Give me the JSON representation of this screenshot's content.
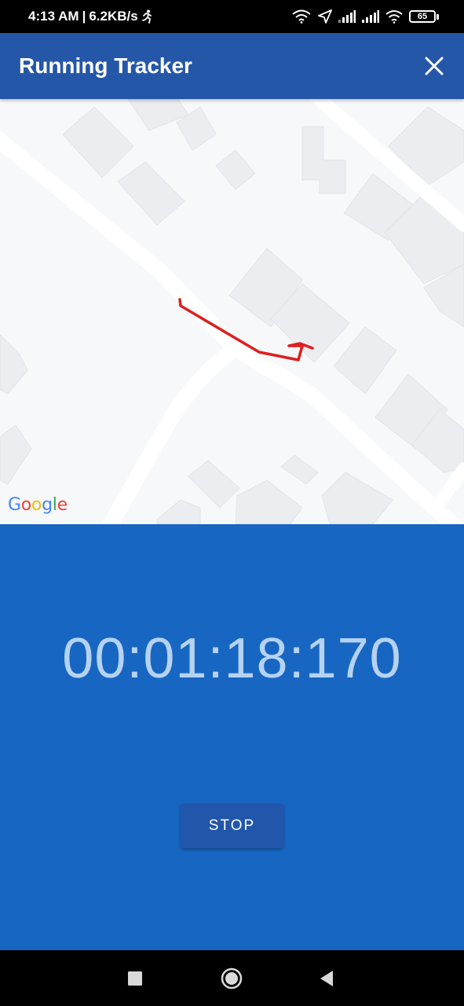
{
  "status_bar": {
    "time": "4:13 AM",
    "separator": "|",
    "network_speed": "6.2KB/s",
    "battery_level": "65",
    "icons": [
      "running-person-icon",
      "wifi-icon",
      "location-arrow-icon",
      "signal-icon",
      "signal-icon",
      "wifi-icon",
      "battery-icon"
    ]
  },
  "app_bar": {
    "title": "Running Tracker",
    "close_icon": "close-icon",
    "background": "#2457a8"
  },
  "map": {
    "provider_logo": "Google",
    "route_color": "#dd1f1f"
  },
  "tracker": {
    "elapsed_time": "00:01:18:170",
    "stop_label": "STOP",
    "panel_color": "#1766c2"
  },
  "nav_bar": {
    "buttons": [
      "recents-icon",
      "home-icon",
      "back-icon"
    ]
  }
}
